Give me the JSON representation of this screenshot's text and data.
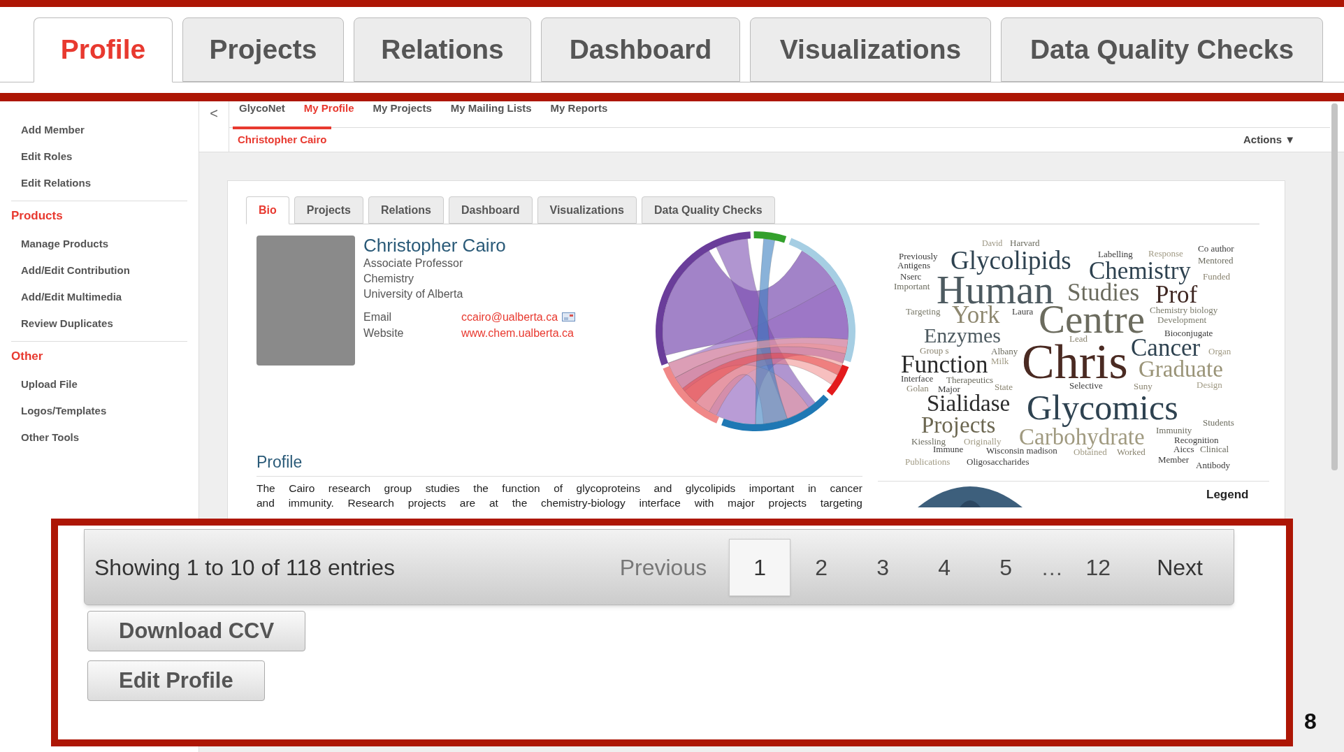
{
  "top_tabs": [
    {
      "label": "Profile",
      "selected": true
    },
    {
      "label": "Projects",
      "selected": false
    },
    {
      "label": "Relations",
      "selected": false
    },
    {
      "label": "Dashboard",
      "selected": false
    },
    {
      "label": "Visualizations",
      "selected": false
    },
    {
      "label": "Data Quality Checks",
      "selected": false
    }
  ],
  "sub_nav": [
    {
      "label": "GlycoNet",
      "selected": false
    },
    {
      "label": "My Profile",
      "selected": true
    },
    {
      "label": "My Projects",
      "selected": false
    },
    {
      "label": "My Mailing Lists",
      "selected": false
    },
    {
      "label": "My Reports",
      "selected": false
    }
  ],
  "sidebar": {
    "items": [
      {
        "kind": "item",
        "label": "Add Member"
      },
      {
        "kind": "item",
        "label": "Edit Roles"
      },
      {
        "kind": "item",
        "label": "Edit Relations"
      },
      {
        "kind": "heading",
        "label": "Products"
      },
      {
        "kind": "item",
        "label": "Manage Products"
      },
      {
        "kind": "item",
        "label": "Add/Edit Contribution"
      },
      {
        "kind": "item",
        "label": "Add/Edit Multimedia"
      },
      {
        "kind": "item",
        "label": "Review Duplicates"
      },
      {
        "kind": "heading",
        "label": "Other"
      },
      {
        "kind": "item",
        "label": "Upload File"
      },
      {
        "kind": "item",
        "label": "Logos/Templates"
      },
      {
        "kind": "item",
        "label": "Other Tools"
      }
    ]
  },
  "back_button": "<",
  "breadcrumb": "Christopher Cairo",
  "actions_menu": "Actions ▼",
  "profile_tabs": [
    {
      "label": "Bio",
      "selected": true
    },
    {
      "label": "Projects",
      "selected": false
    },
    {
      "label": "Relations",
      "selected": false
    },
    {
      "label": "Dashboard",
      "selected": false
    },
    {
      "label": "Visualizations",
      "selected": false
    },
    {
      "label": "Data Quality Checks",
      "selected": false
    }
  ],
  "person": {
    "name": "Christopher Cairo",
    "title": "Associate Professor",
    "department": "Chemistry",
    "institution": "University of Alberta",
    "email_label": "Email",
    "email": "ccairo@ualberta.ca",
    "website_label": "Website",
    "website": "www.chem.ualberta.ca"
  },
  "word_cloud": {
    "words": [
      "David",
      "Harvard",
      "Labelling",
      "Response",
      "Co author",
      "Previously",
      "Glycolipids",
      "Mentored",
      "Antigens",
      "Nserc",
      "Chemistry",
      "Human",
      "Funded",
      "Important",
      "Studies",
      "Prof",
      "Targeting",
      "York",
      "Laura",
      "Centre",
      "Chemistry biology",
      "Development",
      "Enzymes",
      "Bioconjugate",
      "Lead",
      "Group s",
      "Albany",
      "Chris",
      "Cancer",
      "Organ",
      "Function",
      "Milk",
      "Graduate",
      "Interface",
      "Therapeutics",
      "Golan",
      "Major",
      "State",
      "Selective",
      "Suny",
      "Design",
      "Sialidase",
      "Glycomics",
      "Projects",
      "Carbohydrate",
      "Immunity",
      "Students",
      "Kiessling",
      "Originally",
      "Recognition",
      "Immune",
      "Wisconsin madison",
      "Obtained",
      "Worked",
      "Aiccs",
      "Clinical",
      "Publications",
      "Oligosaccharides",
      "Member",
      "Antibody"
    ]
  },
  "profile_section": {
    "heading": "Profile",
    "lines": [
      "The Cairo research group studies the function of glycoproteins and glycolipids important in cancer",
      "and immunity. Research projects are at the chemistry-biology interface with major projects targeting"
    ]
  },
  "legend": "Legend",
  "pagination": {
    "summary": "Showing 1 to 10 of 118 entries",
    "previous": "Previous",
    "pages": [
      {
        "kind": "page",
        "label": "1",
        "selected": true
      },
      {
        "kind": "page",
        "label": "2",
        "selected": false
      },
      {
        "kind": "page",
        "label": "3",
        "selected": false
      },
      {
        "kind": "page",
        "label": "4",
        "selected": false
      },
      {
        "kind": "page",
        "label": "5",
        "selected": false
      },
      {
        "kind": "ellipsis",
        "label": "…"
      },
      {
        "kind": "page",
        "label": "12",
        "selected": false
      }
    ],
    "next": "Next"
  },
  "buttons": [
    "Download CCV",
    "Edit Profile"
  ],
  "slide_number": "8"
}
